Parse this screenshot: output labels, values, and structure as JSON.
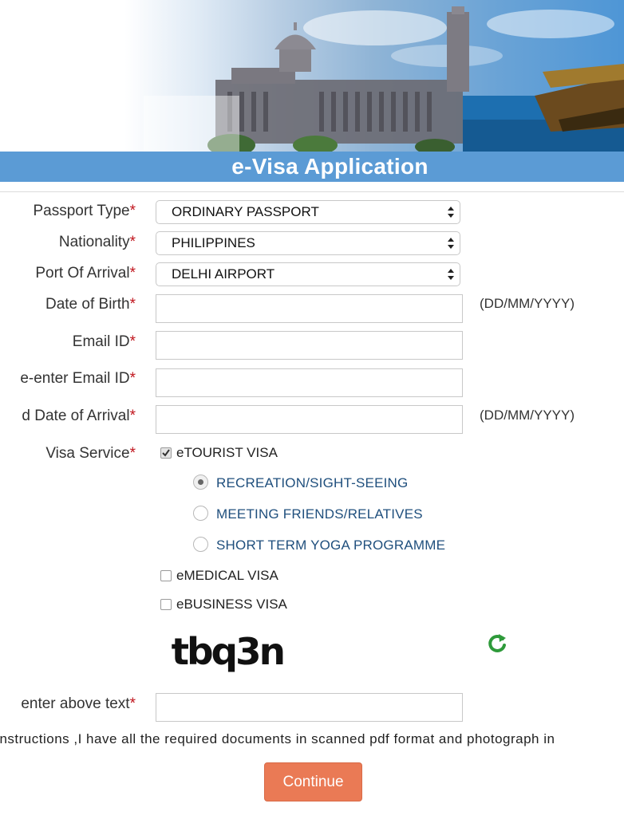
{
  "header": {
    "title": "e-Visa Application"
  },
  "form": {
    "passport_type": {
      "label": "Passport Type",
      "required": "*",
      "value": "ORDINARY PASSPORT"
    },
    "nationality": {
      "label": "Nationality",
      "required": "*",
      "value": "PHILIPPINES"
    },
    "port_of_arrival": {
      "label": "Port Of Arrival",
      "required": "*",
      "value": "DELHI AIRPORT"
    },
    "date_of_birth": {
      "label": "Date of Birth",
      "required": "*",
      "value": "",
      "hint": "(DD/MM/YYYY)"
    },
    "email": {
      "label": "Email ID",
      "required": "*",
      "value": ""
    },
    "reenter_email": {
      "label": "e-enter Email ID",
      "required": "*",
      "value": ""
    },
    "arrival_date": {
      "label": "d Date of Arrival",
      "required": "*",
      "value": "",
      "hint": "(DD/MM/YYYY)"
    },
    "visa_service": {
      "label": "Visa Service",
      "required": "*",
      "options": [
        {
          "label": "eTOURIST VISA",
          "checked": true
        },
        {
          "label": "eMEDICAL VISA",
          "checked": false
        },
        {
          "label": "eBUSINESS VISA",
          "checked": false
        }
      ],
      "tourist_purposes": [
        {
          "label": "RECREATION/SIGHT-SEEING",
          "selected": true
        },
        {
          "label": "MEETING FRIENDS/RELATIVES",
          "selected": false
        },
        {
          "label": "SHORT TERM YOGA PROGRAMME",
          "selected": false
        }
      ]
    },
    "captcha": {
      "text": "tbq3n",
      "input_label": "enter above text",
      "required": "*",
      "value": ""
    },
    "instructions": "e instructions ,I have all the required documents in scanned pdf format and photograph in",
    "continue_label": "Continue"
  },
  "colors": {
    "title_bar": "#5b9bd5",
    "continue_button": "#ea7a55",
    "required_star": "#c0141c",
    "refresh_icon": "#2e9a3a"
  },
  "icons": {
    "refresh": "refresh-icon",
    "select_arrows": "updown-arrows-icon",
    "checkmark": "check-icon"
  }
}
